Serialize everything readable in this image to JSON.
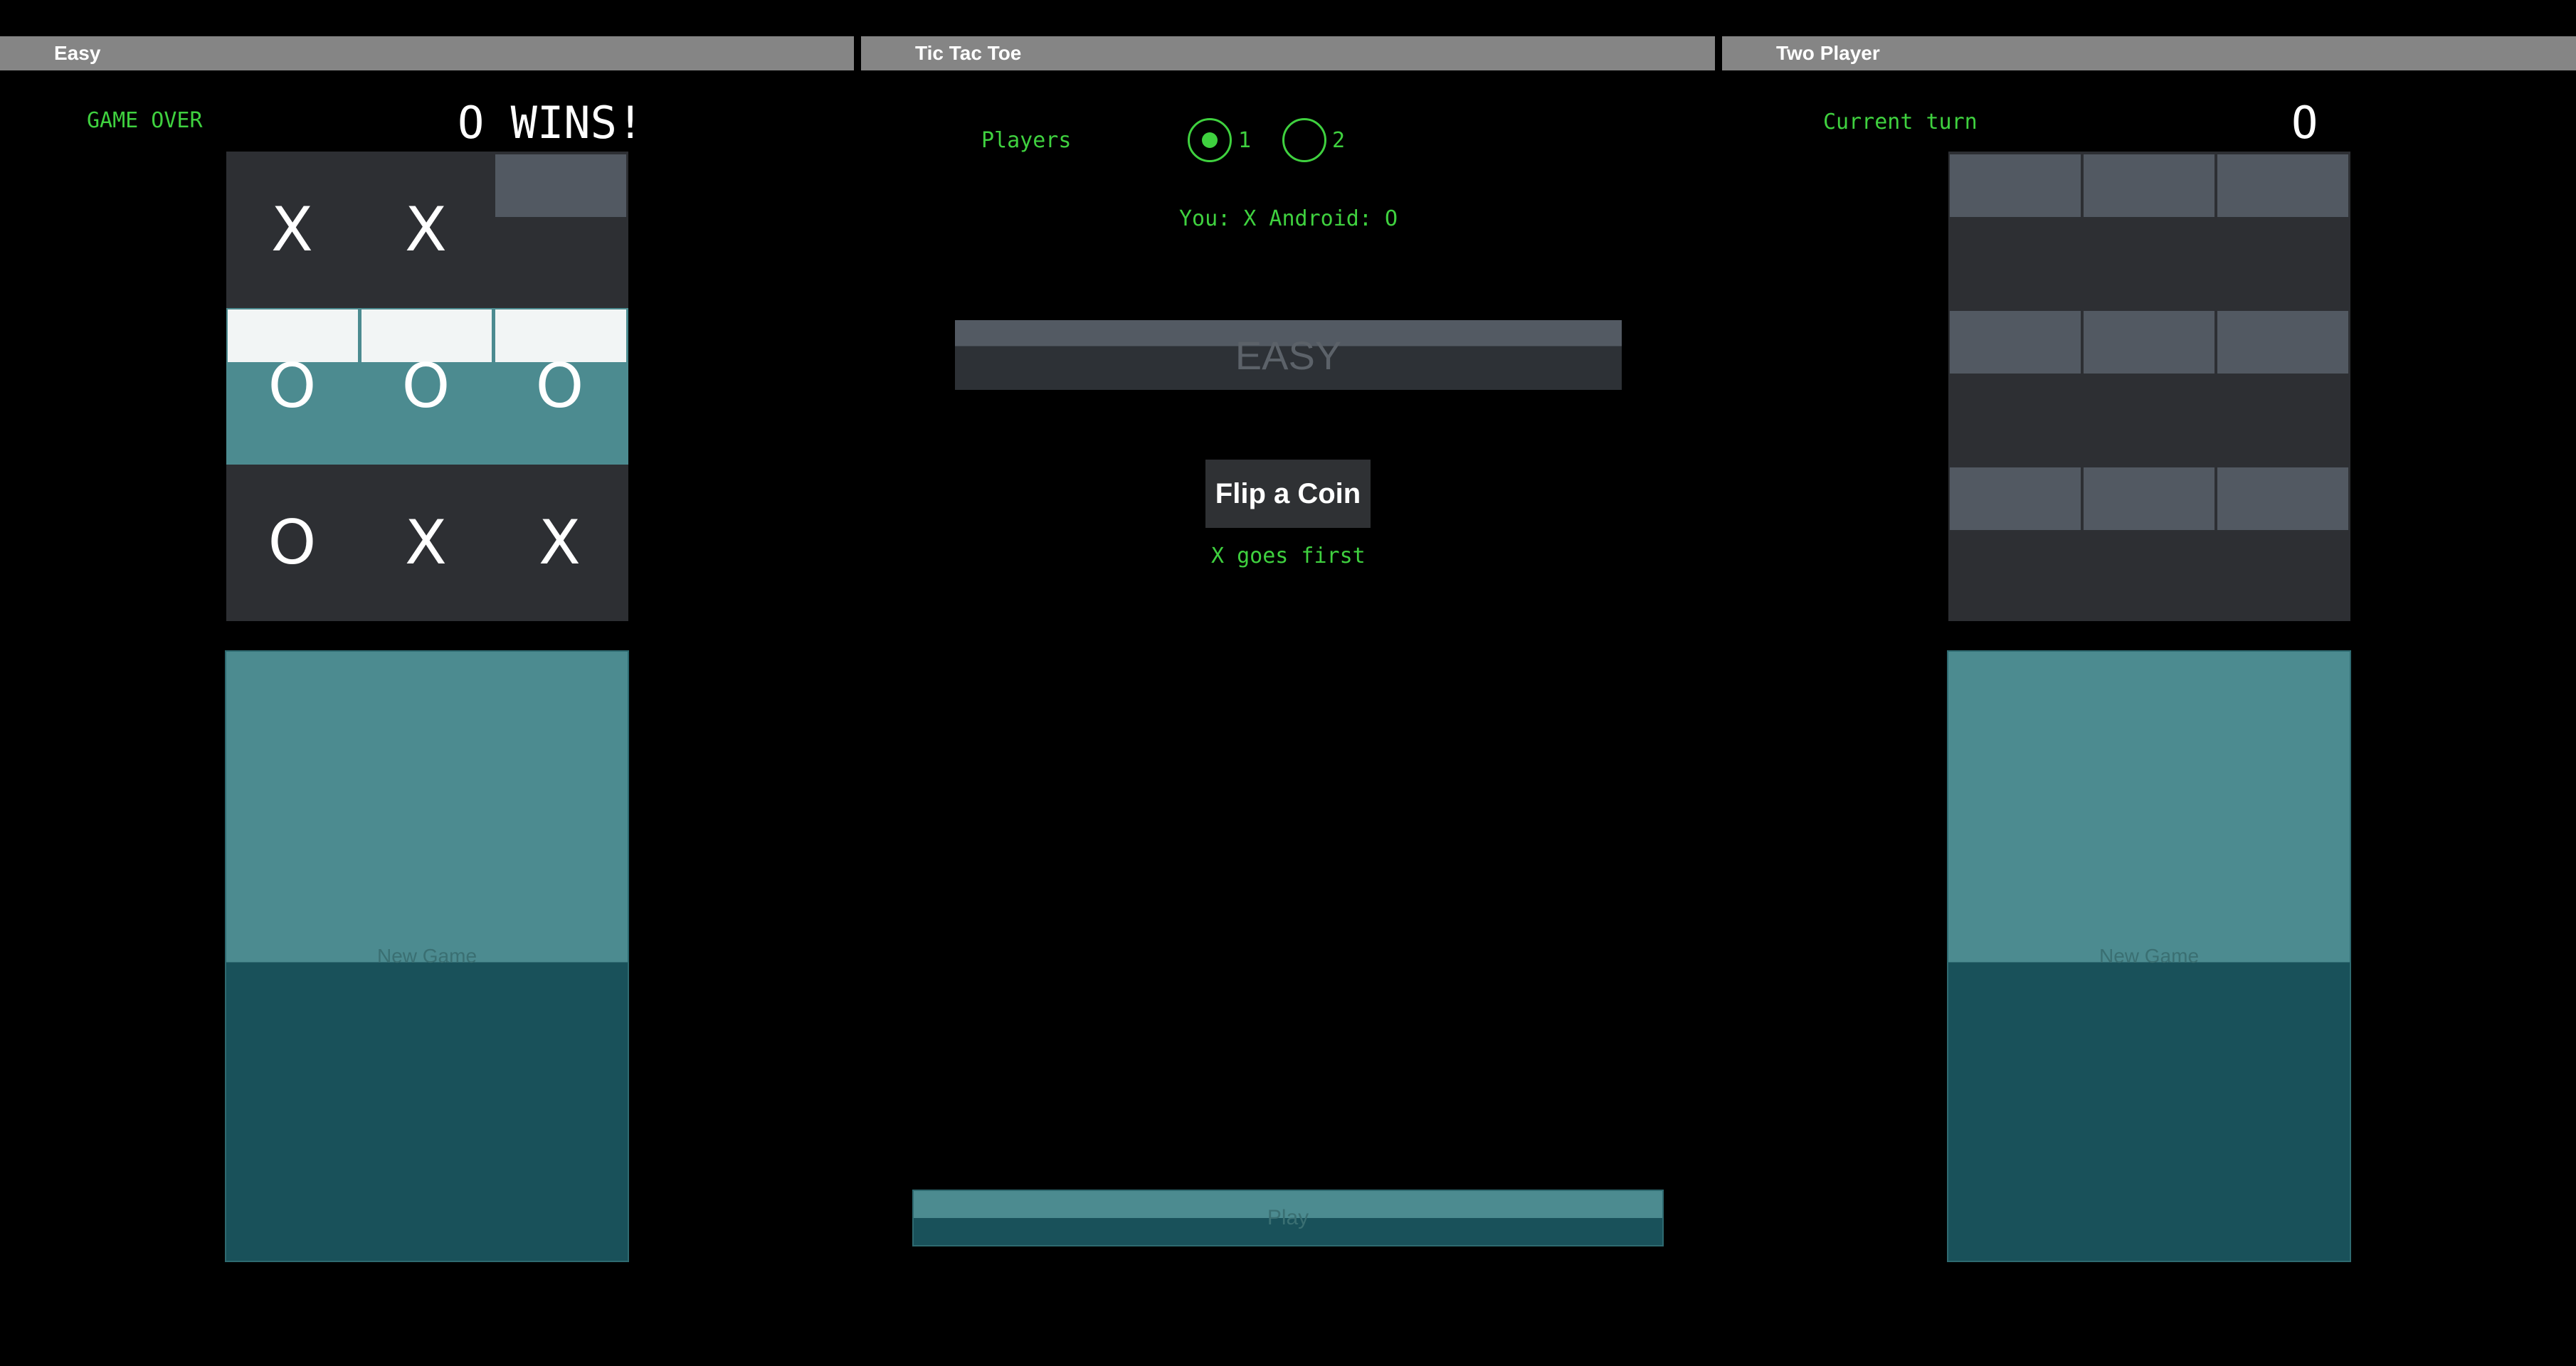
{
  "left_pane": {
    "title": "Easy",
    "status_label": "GAME OVER",
    "status_value": "O WINS!",
    "board": [
      [
        "X",
        "X",
        ""
      ],
      [
        "O",
        "O",
        "O"
      ],
      [
        "O",
        "X",
        "X"
      ]
    ],
    "new_game_label": "New Game"
  },
  "center_pane": {
    "title": "Tic Tac Toe",
    "players_label": "Players",
    "radio_options": [
      "1",
      "2"
    ],
    "selected_player_option": "1",
    "assignment_text": "You: X Android: O",
    "difficulty_selected": "EASY",
    "flip_label": "Flip a Coin",
    "flip_result": "X goes first",
    "play_label": "Play"
  },
  "right_pane": {
    "title": "Two Player",
    "status_label": "Current turn",
    "status_value": "O",
    "board": [
      [
        "",
        "",
        ""
      ],
      [
        "",
        "",
        ""
      ],
      [
        "",
        "",
        ""
      ]
    ],
    "new_game_label": "New Game"
  },
  "colors": {
    "accent_green": "#3fd13f",
    "board_bg": "#2d2f33",
    "teal": "#4c8b90",
    "teal_dark": "#19515a",
    "titlebar": "#858585"
  }
}
